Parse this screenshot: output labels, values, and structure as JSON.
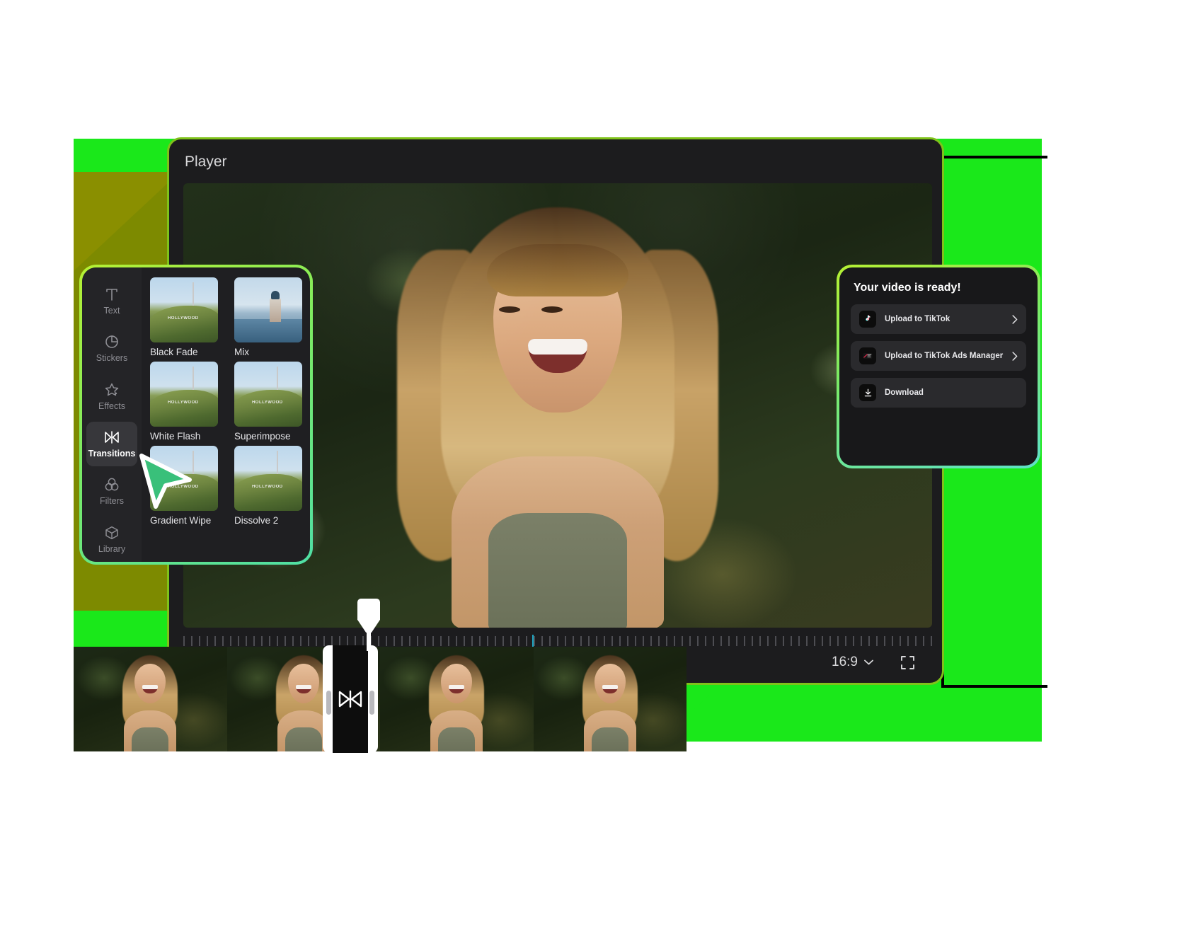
{
  "app": {
    "player_title": "Player"
  },
  "player_controls": {
    "aspect_ratio": "16:9",
    "aspect_icon": "chevron-down-icon",
    "fullscreen_icon": "fullscreen-icon"
  },
  "tool_panel": {
    "rail": [
      {
        "label": "Text",
        "icon": "text-icon",
        "active": false
      },
      {
        "label": "Stickers",
        "icon": "stickers-icon",
        "active": false
      },
      {
        "label": "Effects",
        "icon": "effects-icon",
        "active": false
      },
      {
        "label": "Transitions",
        "icon": "transitions-icon",
        "active": true
      },
      {
        "label": "Filters",
        "icon": "filters-icon",
        "active": false
      },
      {
        "label": "Library",
        "icon": "library-icon",
        "active": false
      }
    ],
    "transitions": [
      {
        "label": "Black Fade",
        "thumb": "hollywood-hills"
      },
      {
        "label": "Mix",
        "thumb": "maidens-tower"
      },
      {
        "label": "White Flash",
        "thumb": "hollywood-hills"
      },
      {
        "label": "Superimpose",
        "thumb": "hollywood-hills"
      },
      {
        "label": "Gradient Wipe",
        "thumb": "hollywood-hills"
      },
      {
        "label": "Dissolve 2",
        "thumb": "hollywood-hills"
      }
    ],
    "thumb_sign_text": "HOLLYWOOD"
  },
  "export_panel": {
    "title": "Your video is ready!",
    "options": [
      {
        "label": "Upload to TikTok",
        "icon": "tiktok-icon",
        "chevron": "chevron-right-icon"
      },
      {
        "label": "Upload to TikTok Ads Manager",
        "icon": "tiktok-ads-manager-icon",
        "chevron": "chevron-right-icon"
      },
      {
        "label": "Download",
        "icon": "download-icon",
        "chevron": ""
      }
    ]
  },
  "timeline": {
    "transition_marker_icon": "transition-bowtie-icon",
    "clip_count": 4
  },
  "colors": {
    "brand_green": "#1ae81a",
    "accent_gradient_start": "#b6f033",
    "accent_gradient_end": "#4fdfa6",
    "panel_bg": "#1f1f22",
    "window_bg": "#1c1c1e",
    "playhead": "#ffffff",
    "ruler_accent": "#1fa8c4"
  }
}
